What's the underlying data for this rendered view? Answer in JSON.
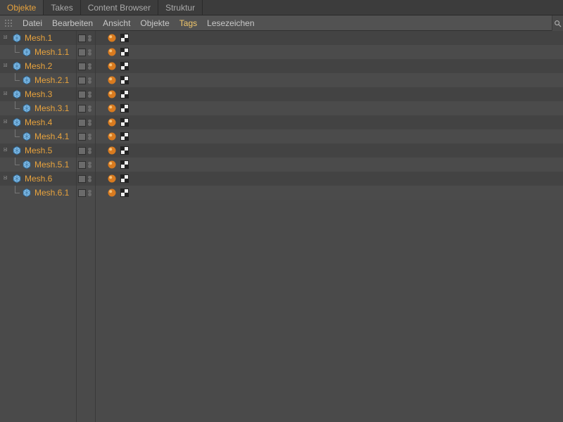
{
  "tabs": [
    {
      "label": "Objekte",
      "active": true
    },
    {
      "label": "Takes",
      "active": false
    },
    {
      "label": "Content Browser",
      "active": false
    },
    {
      "label": "Struktur",
      "active": false
    }
  ],
  "menu": {
    "items": [
      {
        "label": "Datei",
        "active": false
      },
      {
        "label": "Bearbeiten",
        "active": false
      },
      {
        "label": "Ansicht",
        "active": false
      },
      {
        "label": "Objekte",
        "active": false
      },
      {
        "label": "Tags",
        "active": true
      },
      {
        "label": "Lesezeichen",
        "active": false
      }
    ]
  },
  "objects": [
    {
      "name": "Mesh.1",
      "children": [
        {
          "name": "Mesh.1.1"
        }
      ]
    },
    {
      "name": "Mesh.2",
      "children": [
        {
          "name": "Mesh.2.1"
        }
      ]
    },
    {
      "name": "Mesh.3",
      "children": [
        {
          "name": "Mesh.3.1"
        }
      ]
    },
    {
      "name": "Mesh.4",
      "children": [
        {
          "name": "Mesh.4.1"
        }
      ]
    },
    {
      "name": "Mesh.5",
      "children": [
        {
          "name": "Mesh.5.1"
        }
      ]
    },
    {
      "name": "Mesh.6",
      "children": [
        {
          "name": "Mesh.6.1"
        }
      ]
    }
  ],
  "icons": {
    "polygon_object": "polygon-object-icon",
    "phong_tag": "phong-tag-icon",
    "uvw_tag": "uvw-tag-icon"
  }
}
